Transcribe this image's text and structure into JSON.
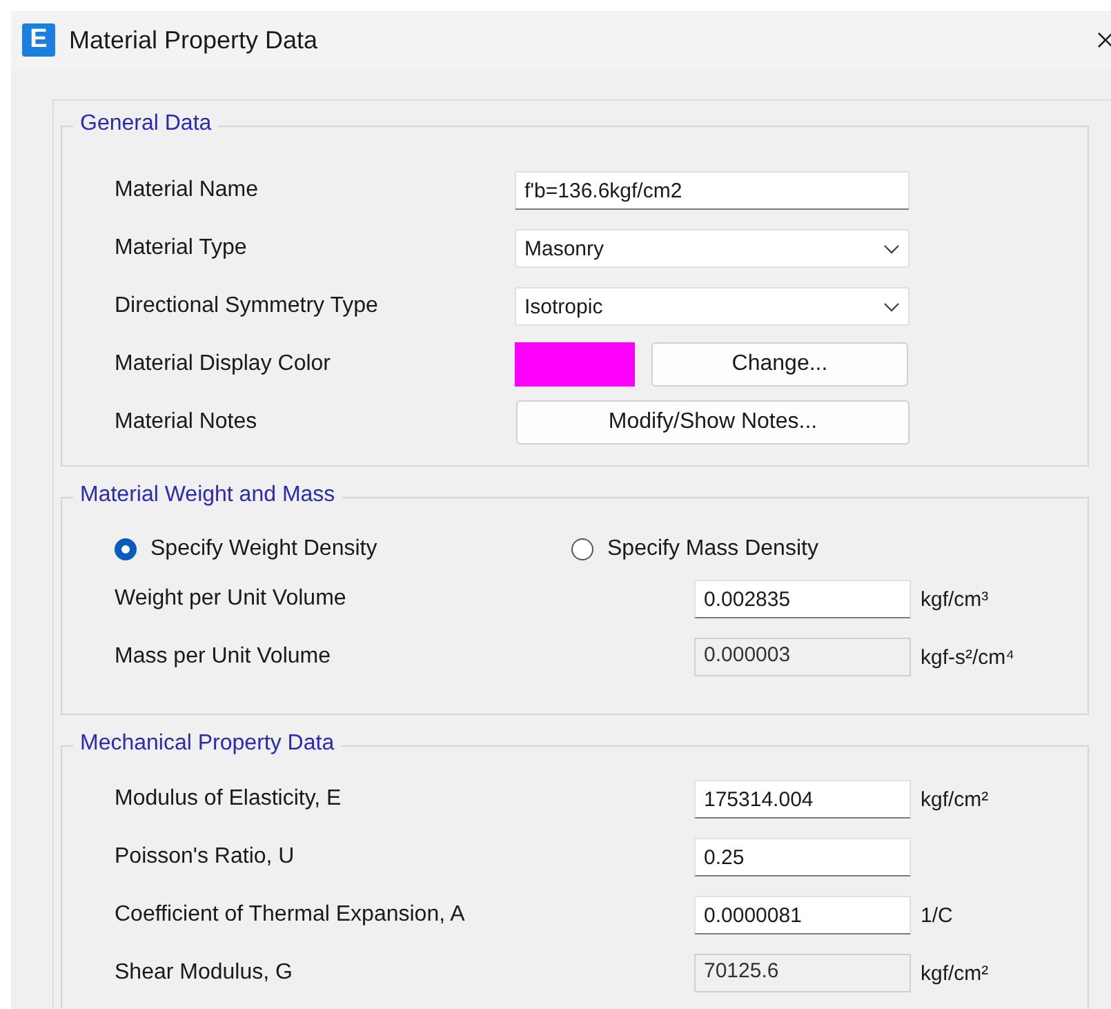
{
  "window": {
    "logo_letter": "E",
    "title": "Material Property Data"
  },
  "general": {
    "title": "General Data",
    "rows": [
      {
        "label": "Material Name",
        "kind": "text",
        "value": "f'b=136.6kgf/cm2"
      },
      {
        "label": "Material Type",
        "kind": "dropdown",
        "value": "Masonry"
      },
      {
        "label": "Directional Symmetry Type",
        "kind": "dropdown",
        "value": "Isotropic"
      },
      {
        "label": "Material Display Color",
        "kind": "color",
        "color": "#ff00ff",
        "button": "Change..."
      },
      {
        "label": "Material Notes",
        "kind": "button",
        "button": "Modify/Show Notes..."
      }
    ]
  },
  "weight": {
    "title": "Material Weight and Mass",
    "options": [
      {
        "label": "Specify Weight Density",
        "selected": true
      },
      {
        "label": "Specify Mass Density",
        "selected": false
      }
    ],
    "rows": [
      {
        "label": "Weight per Unit Volume",
        "value": "0.002835",
        "unit": "kgf/cm³",
        "disabled": false
      },
      {
        "label": "Mass per Unit Volume",
        "value": "0.000003",
        "unit": "kgf-s²/cm⁴",
        "disabled": true
      }
    ]
  },
  "mechanical": {
    "title": "Mechanical Property Data",
    "rows": [
      {
        "label": "Modulus of Elasticity,  E",
        "value": "175314.004",
        "unit": "kgf/cm²",
        "disabled": false
      },
      {
        "label": "Poisson's Ratio,  U",
        "value": "0.25",
        "disabled": false
      },
      {
        "label": "Coefficient of Thermal Expansion,  A",
        "value": "0.0000081",
        "unit": "1/C",
        "disabled": false
      },
      {
        "label": "Shear Modulus,  G",
        "value": "70125.6",
        "unit": "kgf/cm²",
        "disabled": true
      }
    ]
  }
}
